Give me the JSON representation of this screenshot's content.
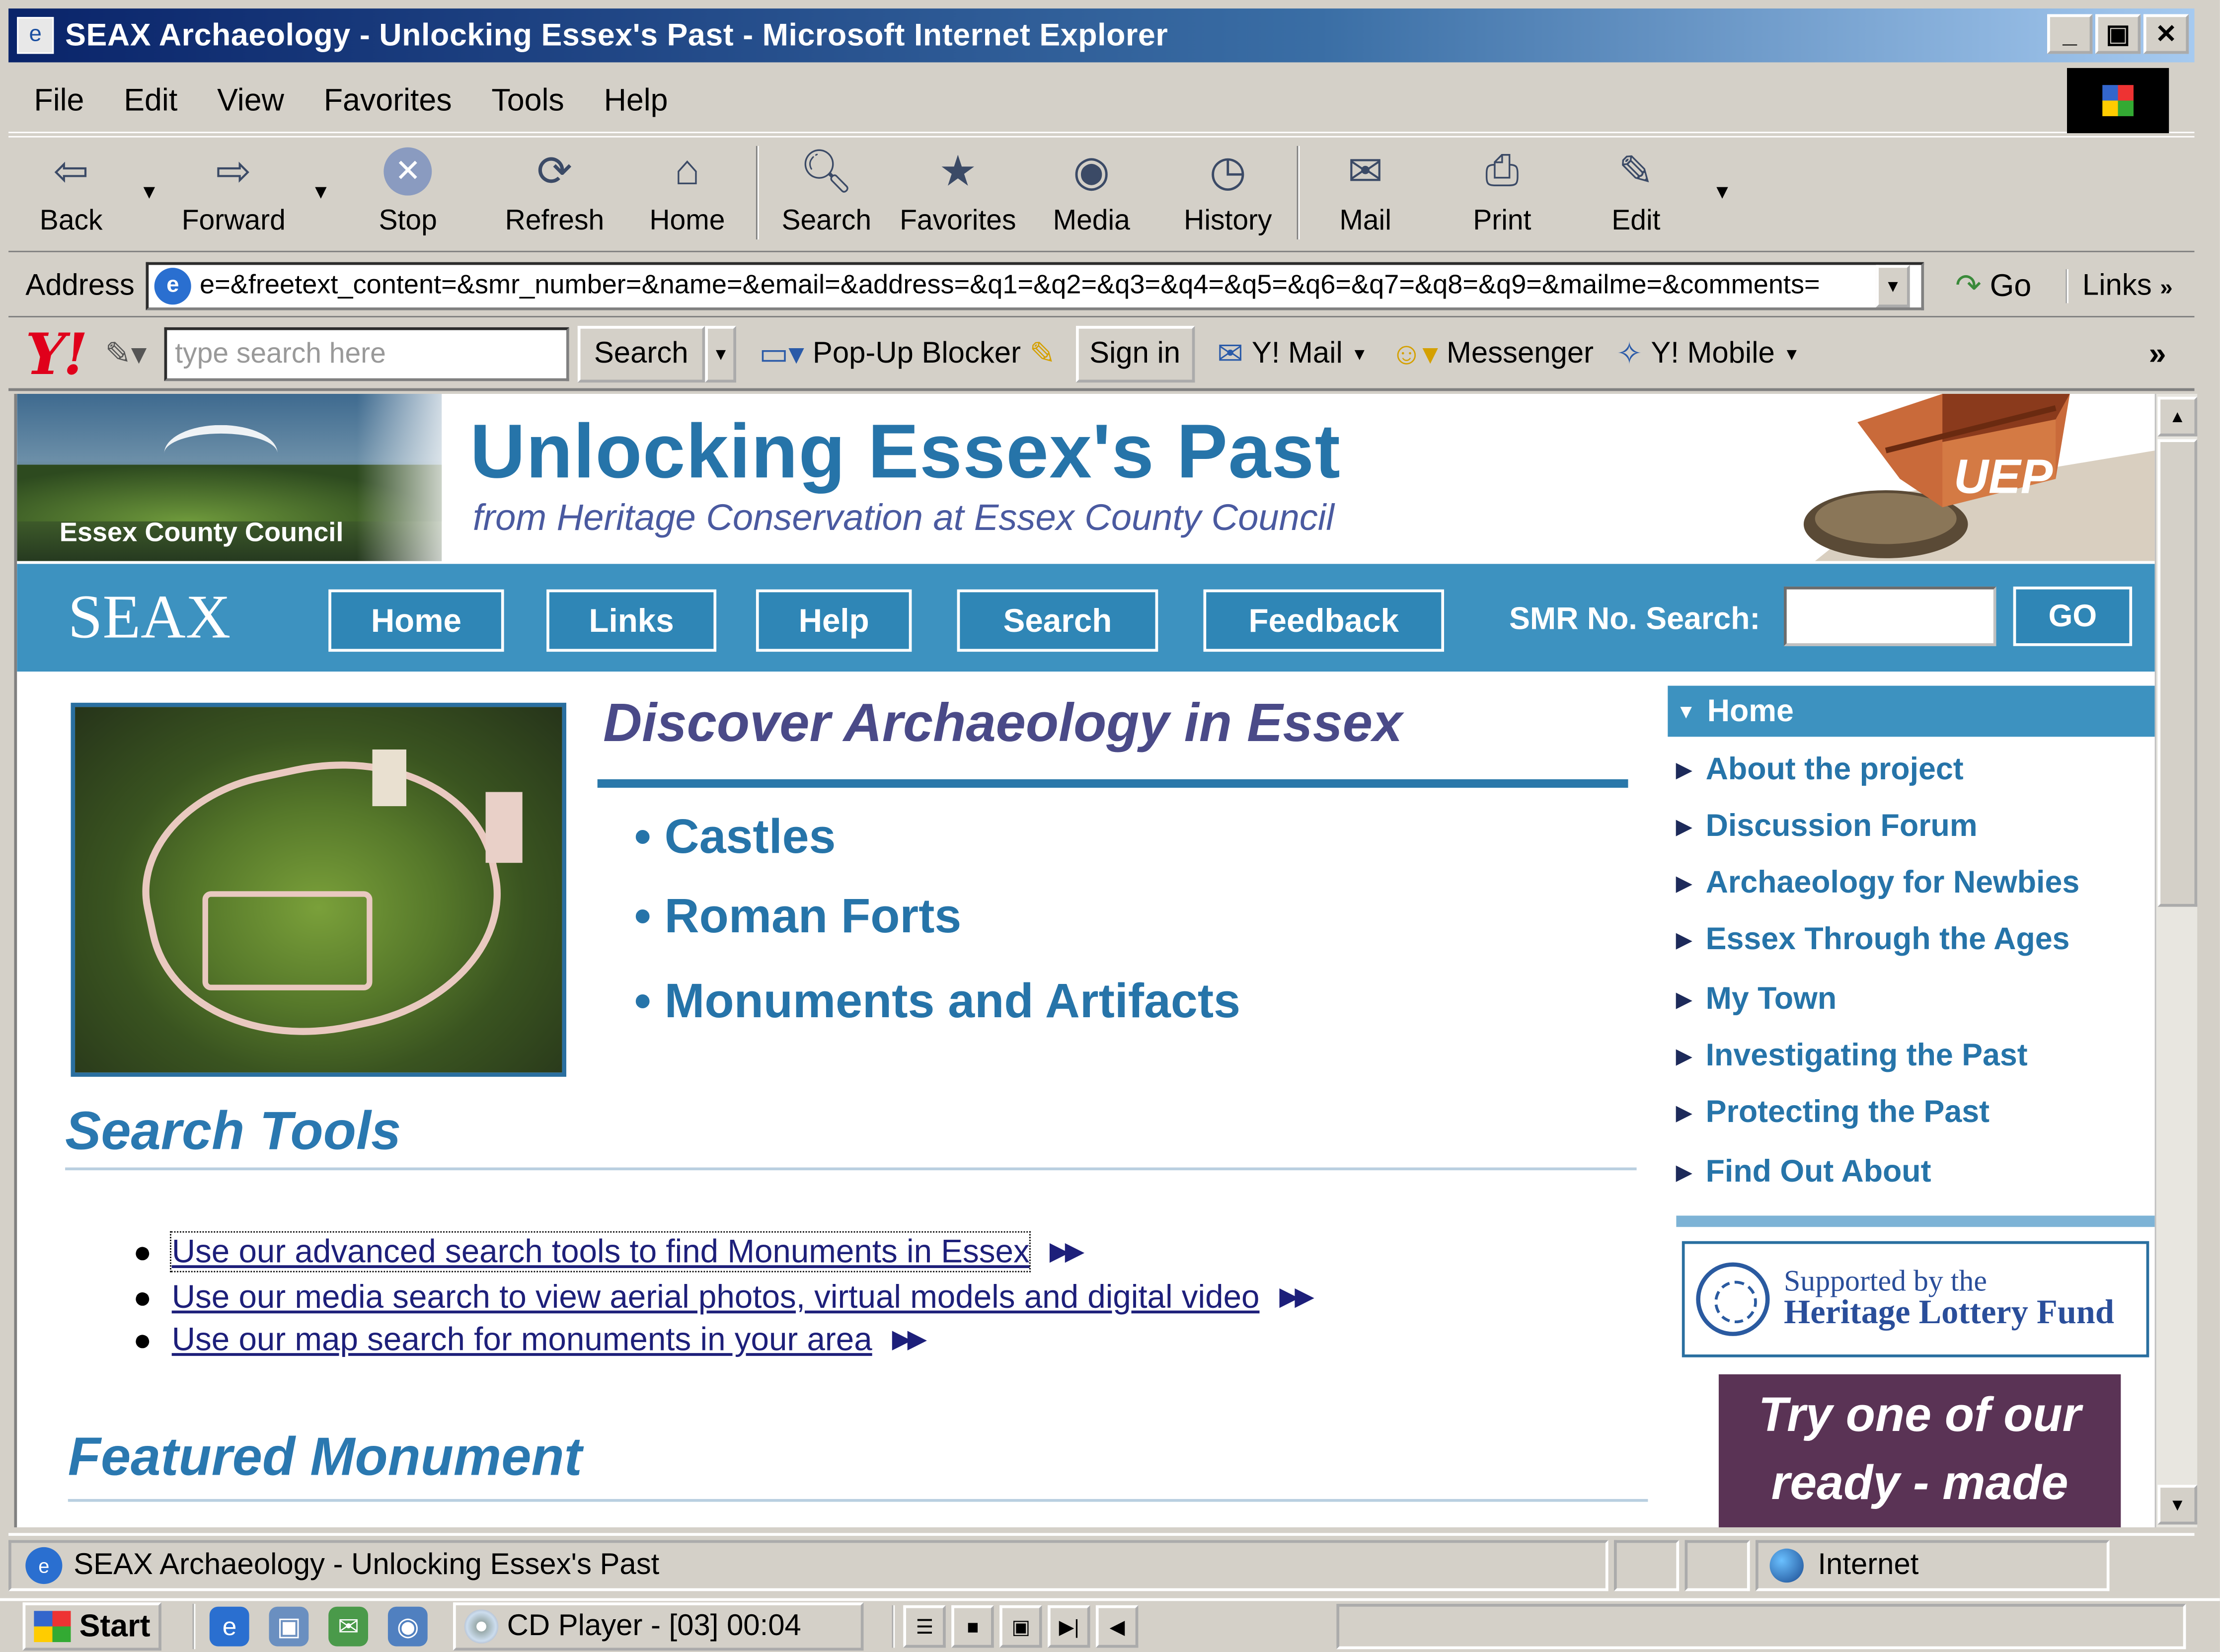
{
  "window": {
    "title": "SEAX Archaeology - Unlocking Essex's Past - Microsoft Internet Explorer",
    "minimize": "_",
    "maximize": "▣",
    "close": "✕"
  },
  "menubar": {
    "items": [
      "File",
      "Edit",
      "View",
      "Favorites",
      "Tools",
      "Help"
    ]
  },
  "toolbar": {
    "back": "Back",
    "forward": "Forward",
    "stop": "Stop",
    "refresh": "Refresh",
    "home": "Home",
    "search": "Search",
    "favorites": "Favorites",
    "media": "Media",
    "history": "History",
    "mail": "Mail",
    "print": "Print",
    "edit": "Edit"
  },
  "address": {
    "label": "Address",
    "url": "e=&freetext_content=&smr_number=&name=&email=&address=&q1=&q2=&q3=&q4=&q5=&q6=&q7=&q8=&q9=&mailme=&comments=",
    "go": "Go",
    "links": "Links"
  },
  "yahoo_bar": {
    "logo": "Y!",
    "search_placeholder": "type search here",
    "search_button": "Search",
    "popup_blocker": "Pop-Up Blocker",
    "sign_in": "Sign in",
    "mail": "Y! Mail",
    "messenger": "Messenger",
    "mobile": "Y! Mobile",
    "more": "»"
  },
  "page": {
    "council_name": "Essex County Council",
    "site_title": "Unlocking Essex's Past",
    "site_subtitle": "from Heritage Conservation at Essex County Council",
    "chest_label": "UEP",
    "nav": {
      "brand": "SEAX",
      "buttons": [
        "Home",
        "Links",
        "Help",
        "Search",
        "Feedback"
      ],
      "smr_label": "SMR No. Search:",
      "smr_go": "GO"
    },
    "discover": {
      "heading": "Discover Archaeology in Essex",
      "items": [
        "Castles",
        "Roman Forts",
        "Monuments and Artifacts"
      ]
    },
    "search_tools": {
      "heading": "Search Tools",
      "links": [
        "Use our advanced search tools to find Monuments in Essex",
        "Use our media search to view aerial photos, virtual models and digital video",
        "Use our map search for monuments in your area"
      ],
      "more_symbol": "▶▶"
    },
    "featured": {
      "heading": "Featured Monument"
    },
    "sidebar": {
      "home": "Home",
      "items": [
        "About the project",
        "Discussion Forum",
        "Archaeology for Newbies",
        "Essex Through the Ages",
        "My Town",
        "Investigating the Past",
        "Protecting the Past",
        "Find Out About"
      ],
      "lottery_line1": "Supported by the",
      "lottery_line2": "Heritage Lottery Fund",
      "try_line1": "Try one of our",
      "try_line2": "ready - made"
    }
  },
  "status": {
    "text": "SEAX Archaeology - Unlocking Essex's Past",
    "zone": "Internet"
  },
  "taskbar": {
    "start": "Start",
    "cd_player": "CD Player - [03] 00:04"
  },
  "colors": {
    "nav_blue": "#3d92c0",
    "title_blue": "#2674a9",
    "link_navy": "#1d1f7a",
    "promo_purple": "#5a3355"
  }
}
